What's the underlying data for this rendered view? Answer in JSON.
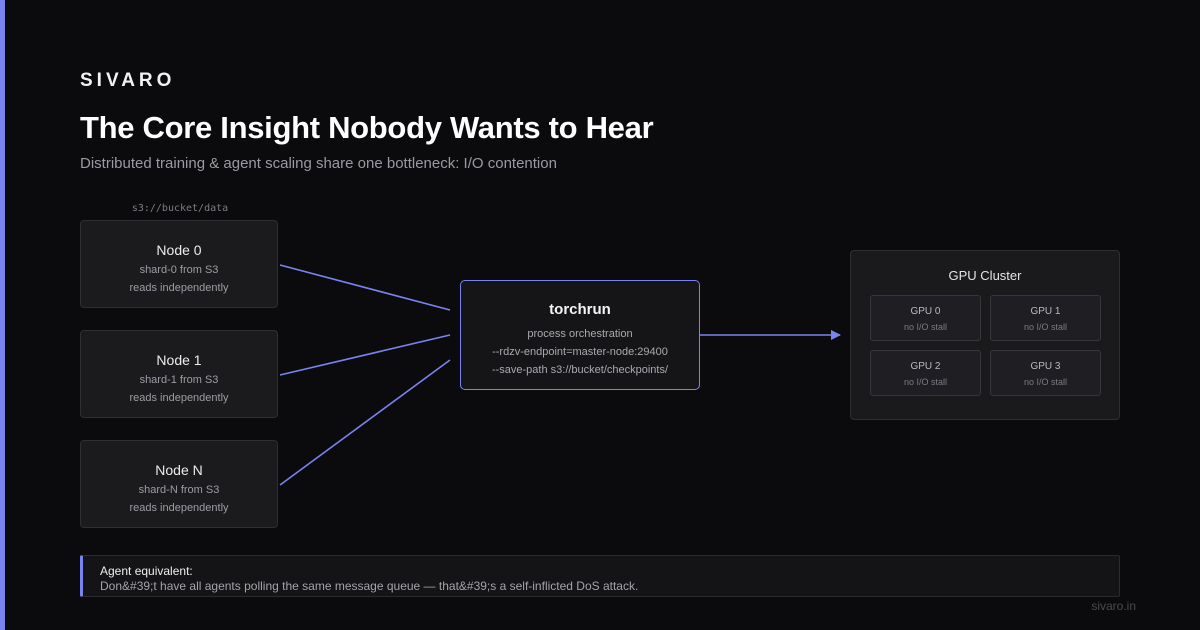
{
  "brand": "SIVARO",
  "title": "The Core Insight Nobody Wants to Hear",
  "subtitle": "Distributed training & agent scaling share one bottleneck: I/O contention",
  "source_label": "s3://bucket/data",
  "nodes": [
    {
      "title": "Node 0",
      "shard": "shard-0 from S3",
      "mode": "reads independently"
    },
    {
      "title": "Node 1",
      "shard": "shard-1 from S3",
      "mode": "reads independently"
    },
    {
      "title": "Node N",
      "shard": "shard-N from S3",
      "mode": "reads independently"
    }
  ],
  "orchestrator": {
    "title": "torchrun",
    "lines": [
      "process orchestration",
      "--rdzv-endpoint=master-node:29400",
      "--save-path s3://bucket/checkpoints/"
    ]
  },
  "cluster": {
    "title": "GPU Cluster",
    "gpus": [
      {
        "name": "GPU 0",
        "status": "no I/O stall"
      },
      {
        "name": "GPU 1",
        "status": "no I/O stall"
      },
      {
        "name": "GPU 2",
        "status": "no I/O stall"
      },
      {
        "name": "GPU 3",
        "status": "no I/O stall"
      }
    ]
  },
  "callout": {
    "label": "Agent equivalent:",
    "text": "Don&#39;t have all agents polling the same message queue — that&#39;s a self-inflicted DoS attack."
  },
  "footer": "sivaro.in",
  "colors": {
    "accent": "#7b83f0",
    "background": "#0b0b0d",
    "panel": "#1b1b1e"
  }
}
